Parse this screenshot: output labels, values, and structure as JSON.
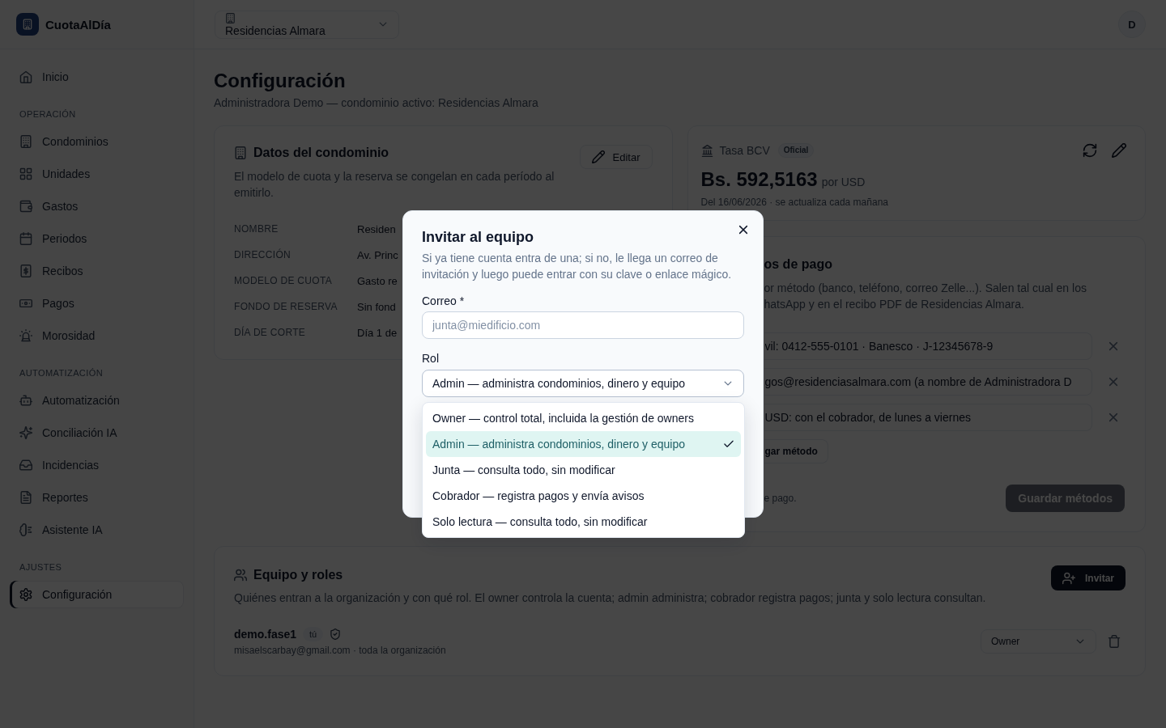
{
  "app": {
    "name": "CuotaAlDía"
  },
  "sidebar": {
    "groups": [
      {
        "items": [
          {
            "label": "Inicio",
            "selected": false
          }
        ]
      },
      {
        "title": "OPERACIÓN",
        "items": [
          {
            "label": "Condominios",
            "selected": false
          },
          {
            "label": "Unidades",
            "selected": false
          },
          {
            "label": "Gastos",
            "selected": false
          },
          {
            "label": "Periodos",
            "selected": false
          },
          {
            "label": "Recibos",
            "selected": false
          },
          {
            "label": "Pagos",
            "selected": false
          },
          {
            "label": "Morosidad",
            "selected": false
          }
        ]
      },
      {
        "title": "AUTOMATIZACIÓN",
        "items": [
          {
            "label": "Automatización",
            "selected": false
          },
          {
            "label": "Conciliación IA",
            "selected": false
          },
          {
            "label": "Incidencias",
            "selected": false
          },
          {
            "label": "Reportes",
            "selected": false
          },
          {
            "label": "Asistente IA",
            "selected": false
          }
        ]
      },
      {
        "title": "AJUSTES",
        "items": [
          {
            "label": "Configuración",
            "selected": true
          }
        ]
      }
    ]
  },
  "topbar": {
    "condo_selector": {
      "value": "Residencias Almara"
    },
    "avatar": {
      "initial": "D"
    }
  },
  "page": {
    "title": "Configuración",
    "subtitle": "Administradora Demo — condominio activo: Residencias Almara"
  },
  "condo_card": {
    "title": "Datos del condominio",
    "edit_button": "Editar",
    "description": "El modelo de cuota y la reserva se congelan en cada período al emitirlo.",
    "fields": [
      {
        "label": "NOMBRE",
        "value": "Residen"
      },
      {
        "label": "DIRECCIÓN",
        "value": "Av. Princ"
      },
      {
        "label": "MODELO DE CUOTA",
        "value": "Gasto re"
      },
      {
        "label": "FONDO DE RESERVA",
        "value": "Sin fond"
      },
      {
        "label": "DÍA DE CORTE",
        "value": "Día 1 de"
      }
    ]
  },
  "rate_card": {
    "title": "Tasa BCV",
    "badge": "Oficial",
    "amount": "Bs. 592,5163",
    "unit": "por USD",
    "note": "Del 16/06/2026 · se actualiza cada mañana"
  },
  "payment_methods_card": {
    "title": "os de pago",
    "description_lines": [
      "or método (banco, teléfono, correo Zelle...). Salen tal cual en los",
      "hatsApp y en el recibo PDF de Residencias Almara."
    ],
    "methods": [
      {
        "value": "vil: 0412-555-0101 · Banesco · J-12345678-9"
      },
      {
        "value": "gos@residenciasalmara.com (a nombre de Administradora D"
      },
      {
        "value": "USD: con el cobrador, de lunes a viernes"
      }
    ],
    "add_button": "gar método",
    "footer_note": "e pago.",
    "save_button": {
      "label": "Guardar métodos",
      "disabled": true
    }
  },
  "team_card": {
    "title": "Equipo y roles",
    "invite_button": "Invitar",
    "description": "Quiénes entran a la organización y con qué rol. El owner controla la cuenta; admin administra; cobrador registra pagos; junta y solo lectura consultan.",
    "members": [
      {
        "name": "demo.fase1",
        "badge": "tú",
        "details": "misaelscarbay@gmail.com · toda la organización",
        "role": "Owner"
      }
    ]
  },
  "invite_dialog": {
    "title": "Invitar al equipo",
    "description": "Si ya tiene cuenta entra de una; si no, le llega un correo de invitación y luego puede entrar con su clave o enlace mágico.",
    "email": {
      "label": "Correo *",
      "placeholder": "junta@miedificio.com"
    },
    "role": {
      "label": "Rol",
      "value": "Admin — administra condominios, dinero y equipo",
      "expanded": true,
      "options": [
        {
          "label": "Owner — control total, incluida la gestión de owners",
          "selected": false
        },
        {
          "label": "Admin — administra condominios, dinero y equipo",
          "selected": true
        },
        {
          "label": "Junta — consulta todo, sin modificar",
          "selected": false
        },
        {
          "label": "Cobrador — registra pagos y envía avisos",
          "selected": false
        },
        {
          "label": "Solo lectura — consulta todo, sin modificar",
          "selected": false
        }
      ]
    }
  }
}
